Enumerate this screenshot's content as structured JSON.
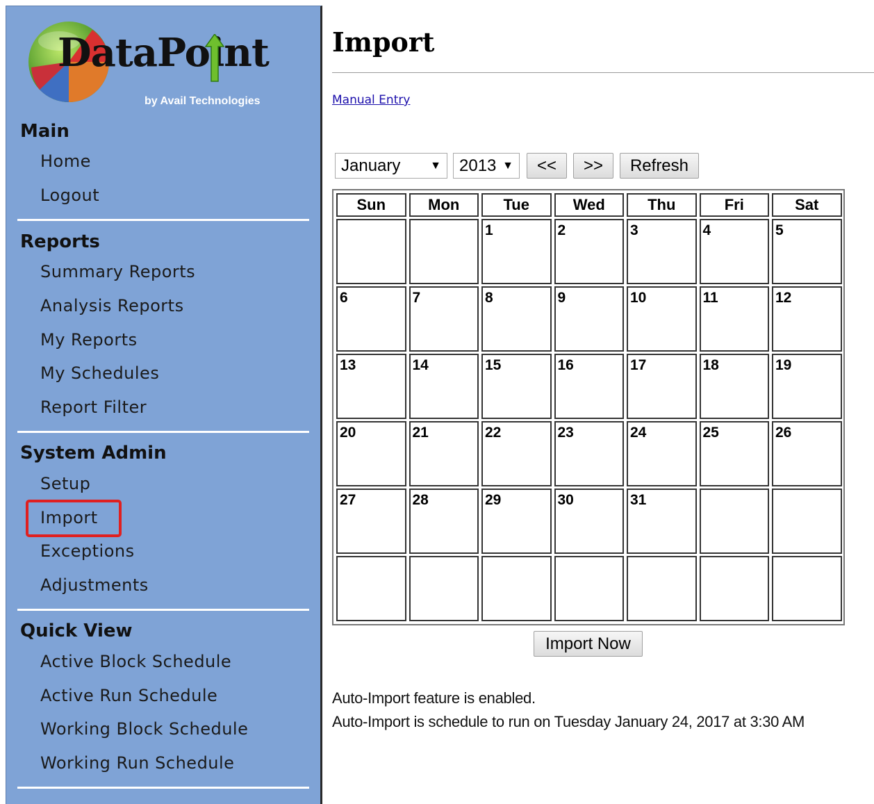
{
  "logo": {
    "brand": "DataPoint",
    "byline": "by Avail Technologies"
  },
  "sidebar": {
    "sections": [
      {
        "heading": "Main",
        "items": [
          "Home",
          "Logout"
        ]
      },
      {
        "heading": "Reports",
        "items": [
          "Summary Reports",
          "Analysis Reports",
          "My Reports",
          "My Schedules",
          "Report Filter"
        ]
      },
      {
        "heading": "System Admin",
        "items": [
          "Setup",
          "Import",
          "Exceptions",
          "Adjustments"
        ]
      },
      {
        "heading": "Quick View",
        "items": [
          "Active Block Schedule",
          "Active Run Schedule",
          "Working Block Schedule",
          "Working Run Schedule"
        ]
      }
    ],
    "highlighted_item": "Import",
    "highlight_color": "#e02020"
  },
  "main": {
    "title": "Import",
    "manual_entry_link": "Manual Entry",
    "controls": {
      "month": "January",
      "year": "2013",
      "prev": "<<",
      "next": ">>",
      "refresh": "Refresh"
    },
    "calendar": {
      "days": [
        "Sun",
        "Mon",
        "Tue",
        "Wed",
        "Thu",
        "Fri",
        "Sat"
      ],
      "weeks": [
        [
          "",
          "",
          "1",
          "2",
          "3",
          "4",
          "5"
        ],
        [
          "6",
          "7",
          "8",
          "9",
          "10",
          "11",
          "12"
        ],
        [
          "13",
          "14",
          "15",
          "16",
          "17",
          "18",
          "19"
        ],
        [
          "20",
          "21",
          "22",
          "23",
          "24",
          "25",
          "26"
        ],
        [
          "27",
          "28",
          "29",
          "30",
          "31",
          "",
          ""
        ],
        [
          "",
          "",
          "",
          "",
          "",
          "",
          ""
        ]
      ]
    },
    "import_now": "Import Now",
    "status_lines": [
      "Auto-Import feature is enabled.",
      "Auto-Import is schedule to run on Tuesday January 24, 2017 at 3:30 AM"
    ]
  },
  "colors": {
    "sidebar_bg": "#7fa3d6",
    "link": "#1a0dab"
  }
}
